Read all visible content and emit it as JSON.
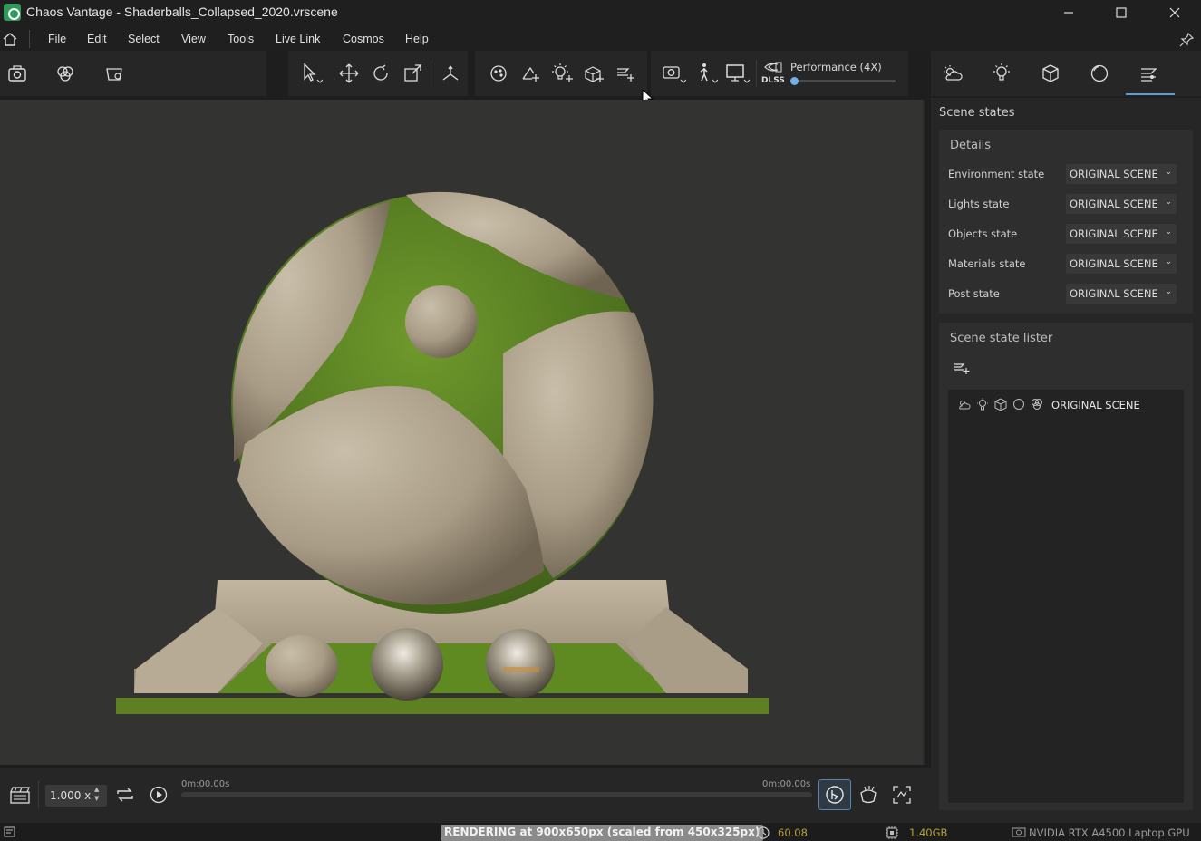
{
  "window": {
    "title": "Chaos Vantage - Shaderballs_Collapsed_2020.vrscene"
  },
  "menu": [
    "File",
    "Edit",
    "Select",
    "View",
    "Tools",
    "Live Link",
    "Cosmos",
    "Help"
  ],
  "toolbar": {
    "dlss_label": "Performance (4X)",
    "dlss_tag": "DLSS",
    "dlss_value": 0.0
  },
  "panel": {
    "title": "Scene states",
    "details": {
      "title": "Details",
      "rows": [
        {
          "label": "Environment state",
          "value": "ORIGINAL SCENE"
        },
        {
          "label": "Lights state",
          "value": "ORIGINAL SCENE"
        },
        {
          "label": "Objects state",
          "value": "ORIGINAL SCENE"
        },
        {
          "label": "Materials state",
          "value": "ORIGINAL SCENE"
        },
        {
          "label": "Post state",
          "value": "ORIGINAL SCENE"
        }
      ]
    },
    "lister": {
      "title": "Scene state lister",
      "items": [
        {
          "label": "ORIGINAL SCENE"
        }
      ]
    }
  },
  "timeline": {
    "speed": "1.000 x",
    "time_start": "0m:00.00s",
    "time_end": "0m:00.00s"
  },
  "status": {
    "render": "RENDERING at 900x650px (scaled from 450x325px)",
    "fps": "60.08",
    "memory": "1.40GB",
    "gpu": "NVIDIA RTX A4500 Laptop GPU"
  },
  "colors": {
    "accent": "#5aa0d8",
    "fps": "#b5a13a",
    "memory": "#b5a13a"
  }
}
